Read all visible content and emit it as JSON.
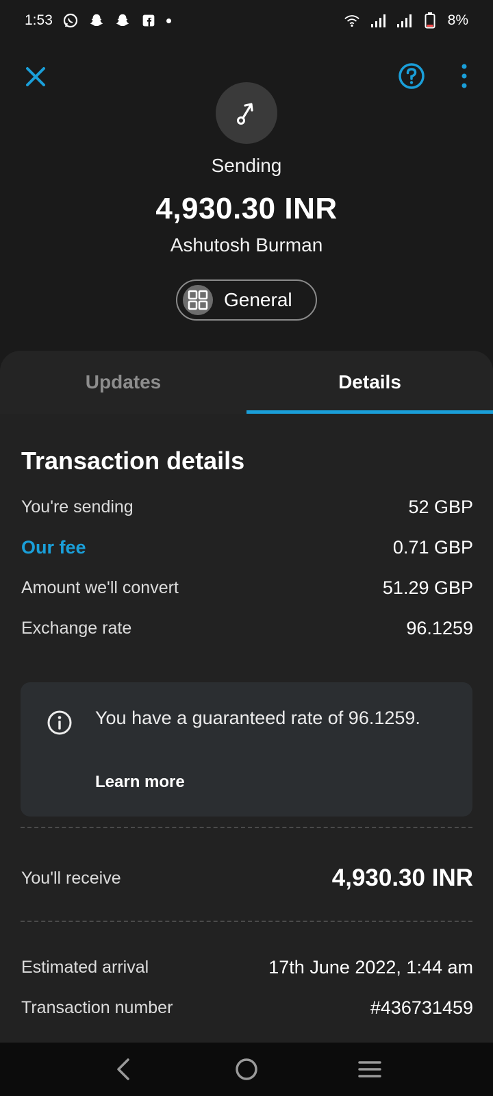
{
  "status_bar": {
    "time": "1:53",
    "notification_icons": [
      "whatsapp-icon",
      "snapchat-icon",
      "snapchat-icon",
      "facebook-icon",
      "dot"
    ],
    "battery": "8%"
  },
  "header": {
    "status": "Sending",
    "amount": "4,930.30 INR",
    "recipient": "Ashutosh Burman",
    "category": "General"
  },
  "tabs": [
    {
      "label": "Updates",
      "active": false
    },
    {
      "label": "Details",
      "active": true
    }
  ],
  "details": {
    "title": "Transaction details",
    "rows": [
      {
        "label": "You're sending",
        "value": "52 GBP"
      },
      {
        "label": "Our fee",
        "value": "0.71 GBP",
        "highlight": true
      },
      {
        "label": "Amount we'll convert",
        "value": "51.29 GBP"
      },
      {
        "label": "Exchange rate",
        "value": "96.1259"
      }
    ],
    "info": {
      "text": "You have a guaranteed rate of 96.1259.",
      "link": "Learn more"
    },
    "receive": {
      "label": "You'll receive",
      "value": "4,930.30 INR"
    },
    "extra_rows": [
      {
        "label": "Estimated arrival",
        "value": "17th June 2022, 1:44 am"
      },
      {
        "label": "Transaction number",
        "value": "#436731459"
      }
    ]
  },
  "colors": {
    "accent": "#1a9fd9",
    "background": "#1a1a1a",
    "panel": "#222222",
    "info_box": "#2b2e31"
  }
}
